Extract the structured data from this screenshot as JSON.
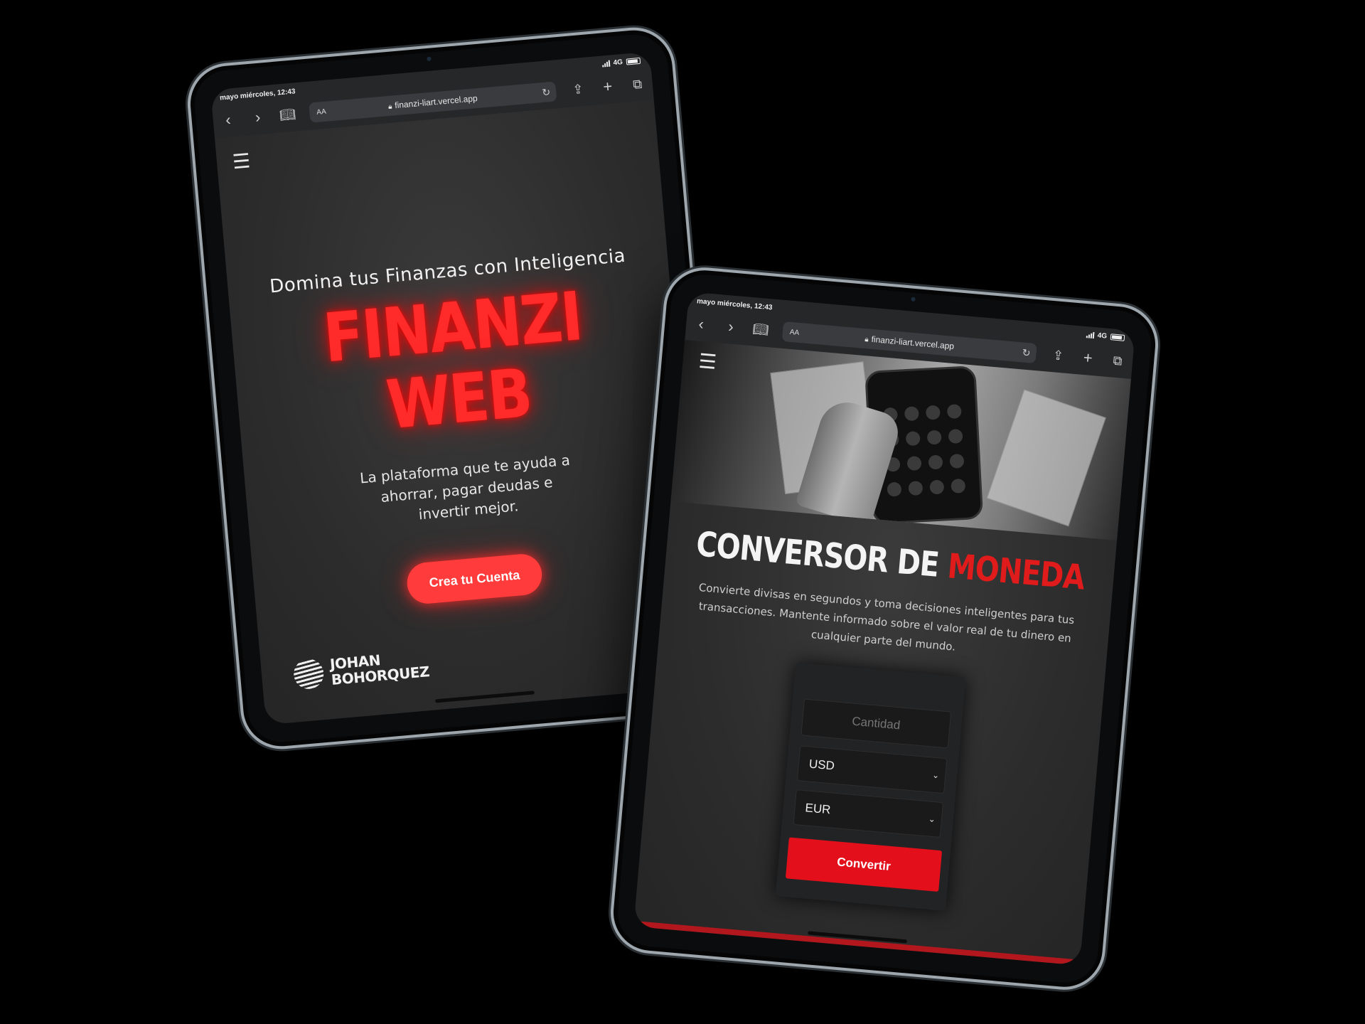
{
  "left_device": {
    "status": {
      "date_time": "mayo miércoles, 12:43",
      "network": "4G"
    },
    "browser": {
      "text_size_label": "AA",
      "url": "finanzi-liart.vercel.app",
      "back_icon": "chevron-left-icon",
      "forward_icon": "chevron-right-icon"
    },
    "hero": {
      "tagline": "Domina tus Finanzas con Inteligencia",
      "title_line1": "FINANZI",
      "title_line2": "WEB",
      "description": "La plataforma que te ayuda a ahorrar, pagar deudas e invertir mejor.",
      "cta_label": "Crea tu Cuenta"
    },
    "brand": {
      "line1": "JOHAN",
      "line2": "BOHORQUEZ"
    }
  },
  "right_device": {
    "status": {
      "date_time": "mayo miércoles, 12:43",
      "network": "4G"
    },
    "browser": {
      "text_size_label": "AA",
      "url": "finanzi-liart.vercel.app"
    },
    "converter": {
      "title_part1": "CONVERSOR DE",
      "title_part2": "MONEDA",
      "description": "Convierte divisas en segundos y toma decisiones inteligentes para tus transacciones. Mantente informado sobre el valor real de tu dinero en cualquier parte del mundo.",
      "amount_placeholder": "Cantidad",
      "from_currency": "USD",
      "to_currency": "EUR",
      "convert_label": "Convertir"
    }
  },
  "colors": {
    "accent_red": "#ff2a2a",
    "button_red": "#e3101c",
    "background": "#000000",
    "screen_bg": "#2c2c2c"
  }
}
